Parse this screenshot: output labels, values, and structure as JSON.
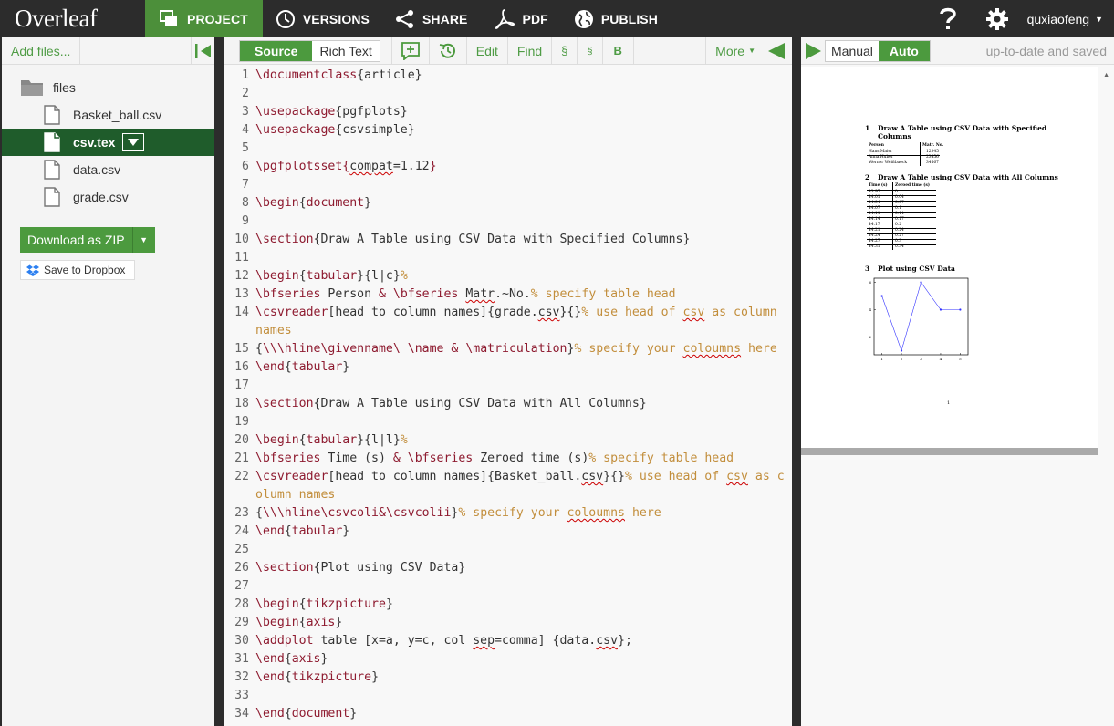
{
  "app": {
    "logo": "Overleaf",
    "nav": [
      {
        "label": "PROJECT",
        "icon": "project-icon"
      },
      {
        "label": "VERSIONS",
        "icon": "history-icon"
      },
      {
        "label": "SHARE",
        "icon": "share-icon"
      },
      {
        "label": "PDF",
        "icon": "pdf-icon"
      },
      {
        "label": "PUBLISH",
        "icon": "globe-icon"
      }
    ],
    "help_icon": "question-icon",
    "settings_icon": "gear-icon",
    "user": "quxiaofeng"
  },
  "sidebar": {
    "add_files": "Add files...",
    "folder": "files",
    "files": [
      "Basket_ball.csv",
      "csv.tex",
      "data.csv",
      "grade.csv"
    ],
    "selected_file": "csv.tex",
    "download_zip": "Download as ZIP",
    "dropbox": "Save to Dropbox"
  },
  "editor": {
    "mode_source": "Source",
    "mode_rich": "Rich Text",
    "toolbar": {
      "edit": "Edit",
      "find": "Find",
      "section1": "§",
      "section2": "§",
      "bold": "B",
      "more": "More"
    },
    "line_numbers": [
      "1",
      "2",
      "3",
      "4",
      "5",
      "6",
      "7",
      "8",
      "9",
      "10",
      "11",
      "12",
      "13",
      "14",
      "15",
      "16",
      "17",
      "18",
      "19",
      "20",
      "21",
      "22",
      "23",
      "24",
      "25",
      "26",
      "27",
      "28",
      "29",
      "30",
      "31",
      "32",
      "33",
      "34"
    ]
  },
  "preview": {
    "manual": "Manual",
    "auto": "Auto",
    "status": "up-to-date and saved",
    "pdf": {
      "sec1_num": "1",
      "sec1_title_a": "Draw A Table using CSV Data with Specified",
      "sec1_title_b": "Columns",
      "t1_head": [
        "Person",
        "Matr. No."
      ],
      "t1_rows": [
        [
          "Hans Maier",
          "12345"
        ],
        [
          "Anna Huber",
          "23456"
        ],
        [
          "Werner Weißbaeck",
          "34567"
        ]
      ],
      "sec2_num": "2",
      "sec2_title": "Draw A Table using CSV Data with All Columns",
      "t2_head": [
        "Time (s)",
        "Zeroed time (s)"
      ],
      "t2_rows": [
        [
          "43.97",
          "0"
        ],
        [
          "44.01",
          "0.04"
        ],
        [
          "44.04",
          "0.07"
        ],
        [
          "44.07",
          "0.1"
        ],
        [
          "44.11",
          "0.14"
        ],
        [
          "44.14",
          "0.17"
        ],
        [
          "44.17",
          "0.2"
        ],
        [
          "44.21",
          "0.24"
        ],
        [
          "44.24",
          "0.27"
        ],
        [
          "44.27",
          "0.3"
        ],
        [
          "44.31",
          "0.34"
        ]
      ],
      "sec3_num": "3",
      "sec3_title": "Plot using CSV Data",
      "page_number": "1"
    }
  },
  "chart_data": {
    "type": "line",
    "x": [
      1,
      2,
      3,
      4,
      5
    ],
    "y": [
      5,
      1,
      6,
      4,
      4
    ],
    "xlim": [
      0.6,
      5.4
    ],
    "ylim": [
      0.7,
      6.3
    ],
    "xticks": [
      "1",
      "2",
      "3",
      "4",
      "5"
    ],
    "yticks": [
      "2",
      "4",
      "6"
    ],
    "color": "#3333ff"
  }
}
